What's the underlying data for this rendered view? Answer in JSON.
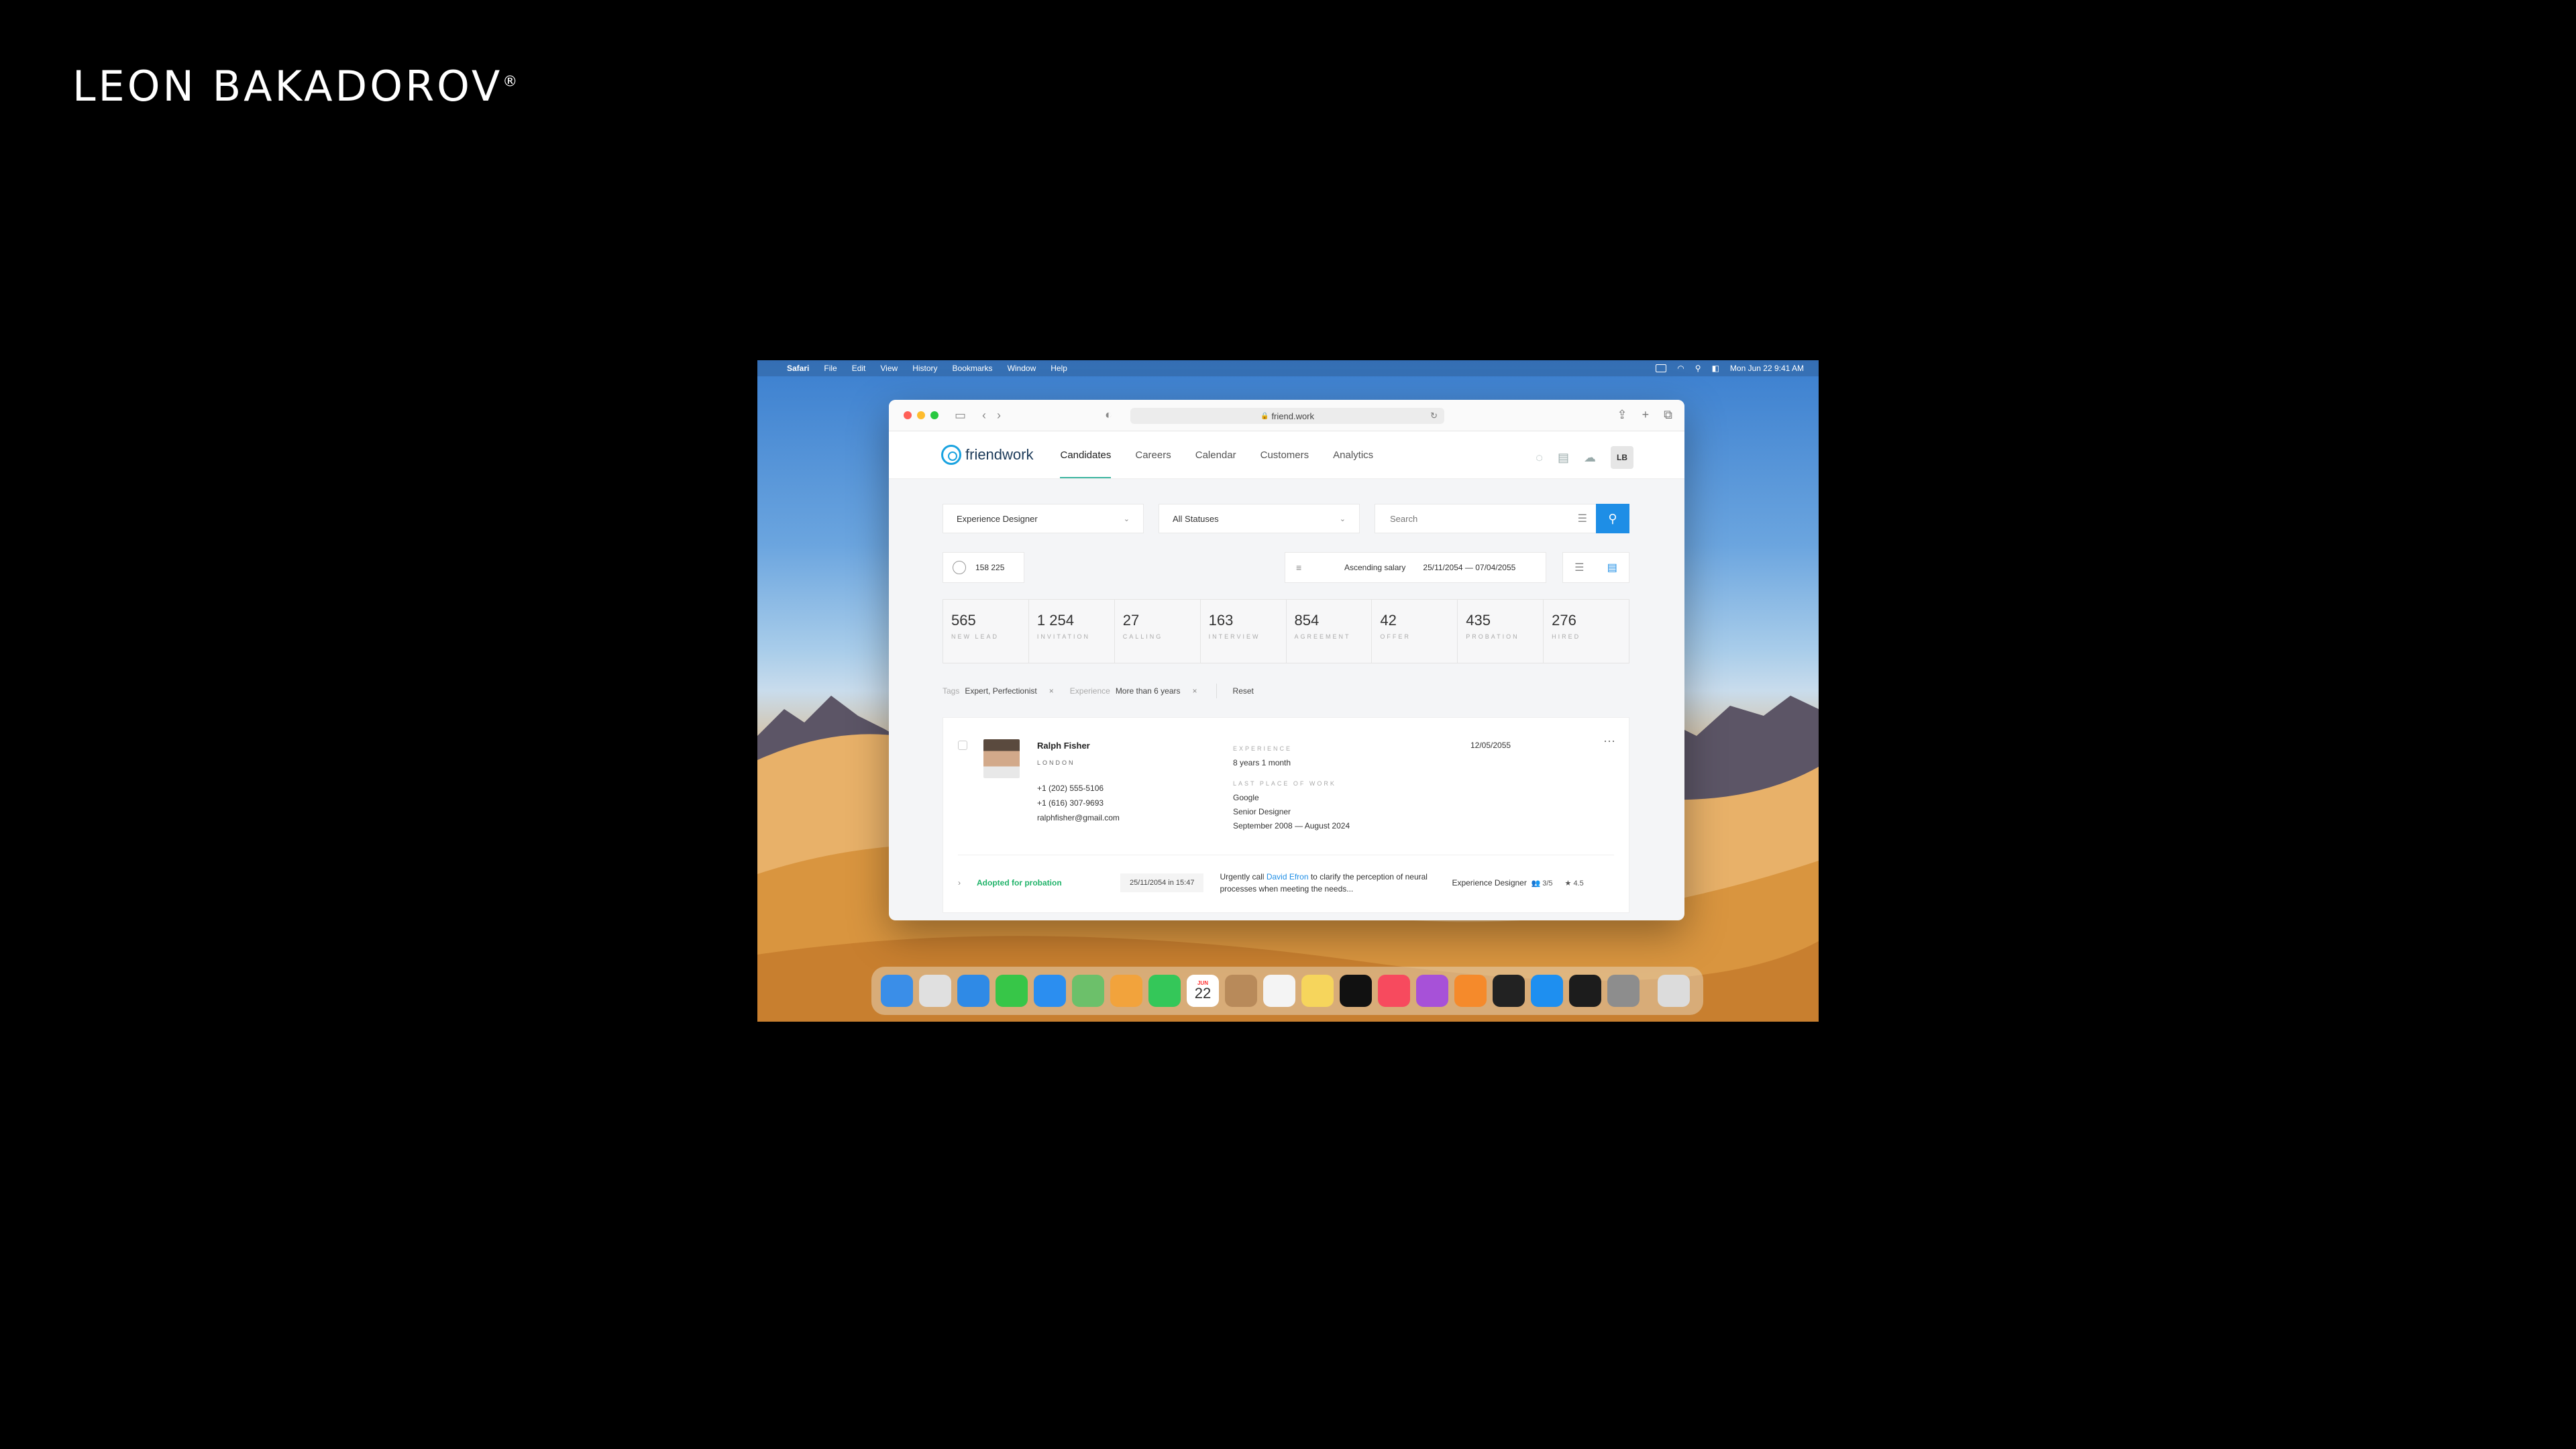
{
  "brand": {
    "name": "LEON BAKADOROV",
    "mark": "®"
  },
  "menubar": {
    "apple": "",
    "items": [
      "Safari",
      "File",
      "Edit",
      "View",
      "History",
      "Bookmarks",
      "Window",
      "Help"
    ],
    "datetime": "Mon Jun 22  9:41 AM"
  },
  "browser": {
    "url": "friend.work",
    "colors": {
      "close": "#ff5f57",
      "minimize": "#febc2e",
      "zoom": "#28c840"
    }
  },
  "app": {
    "logo": "friendwork",
    "tabs": [
      "Candidates",
      "Careers",
      "Calendar",
      "Customers",
      "Analytics"
    ],
    "active_tab": "Candidates",
    "user_initials": "LB"
  },
  "filters": {
    "vacancy": "Experience Designer",
    "status": "All Statuses",
    "search_placeholder": "Search"
  },
  "summary": {
    "count": "158 225",
    "sort": "Ascending salary",
    "date_range": "25/11/2054 — 07/04/2055"
  },
  "stages": [
    {
      "value": "565",
      "label": "NEW LEAD"
    },
    {
      "value": "1 254",
      "label": "INVITATION"
    },
    {
      "value": "27",
      "label": "CALLING"
    },
    {
      "value": "163",
      "label": "INTERVIEW"
    },
    {
      "value": "854",
      "label": "AGREEMENT"
    },
    {
      "value": "42",
      "label": "OFFER"
    },
    {
      "value": "435",
      "label": "PROBATION"
    },
    {
      "value": "276",
      "label": "HIRED"
    }
  ],
  "active_filters": {
    "tags_key": "Tags",
    "tags_value": "Expert, Perfectionist",
    "exp_key": "Experience",
    "exp_value": "More than 6 years",
    "remove": "×",
    "reset": "Reset"
  },
  "candidate": {
    "name": "Ralph Fisher",
    "city": "LONDON",
    "phone1": "+1 (202) 555-5106",
    "phone2": "+1 (616) 307-9693",
    "email": "ralphfisher@gmail.com",
    "experience_label": "EXPERIENCE",
    "experience": "8 years 1 month",
    "last_place_label": "LAST PLACE OF WORK",
    "company": "Google",
    "position": "Senior Designer",
    "period": "September 2008 — August 2024",
    "date": "12/05/2055",
    "status": "Adopted for probation",
    "stamp": "25/11/2054 in 15:47",
    "note_before": "Urgently call ",
    "note_link": "David Efron",
    "note_after": " to clarify the perception of neural processes when meeting the needs...",
    "role": "Experience Designer",
    "tasks": "3/5",
    "rating": "4.5"
  },
  "dock": {
    "apps": [
      {
        "name": "finder",
        "color": "#3a8ee8"
      },
      {
        "name": "launchpad",
        "color": "#e0e0e0"
      },
      {
        "name": "safari",
        "color": "#2f8ae6"
      },
      {
        "name": "messages",
        "color": "#37c648"
      },
      {
        "name": "mail",
        "color": "#2b8ef0"
      },
      {
        "name": "maps",
        "color": "#6cc06a"
      },
      {
        "name": "photos",
        "color": "#f2a33c"
      },
      {
        "name": "facetime",
        "color": "#34c759"
      },
      {
        "name": "calendar",
        "color": "#ffffff"
      },
      {
        "name": "contacts",
        "color": "#b88a5a"
      },
      {
        "name": "reminders",
        "color": "#f4f4f4"
      },
      {
        "name": "notes",
        "color": "#f6d55c"
      },
      {
        "name": "tv",
        "color": "#111111"
      },
      {
        "name": "music",
        "color": "#f74a5e"
      },
      {
        "name": "podcasts",
        "color": "#a751d8"
      },
      {
        "name": "books",
        "color": "#f58a2b"
      },
      {
        "name": "voice-memos",
        "color": "#222222"
      },
      {
        "name": "app-store",
        "color": "#1e8ff0"
      },
      {
        "name": "terminal",
        "color": "#1c1c1c"
      },
      {
        "name": "system-preferences",
        "color": "#8d8d8d"
      },
      {
        "name": "trash",
        "color": "#dcdcdc"
      }
    ],
    "calendar_day": "22",
    "calendar_month": "JUN"
  }
}
